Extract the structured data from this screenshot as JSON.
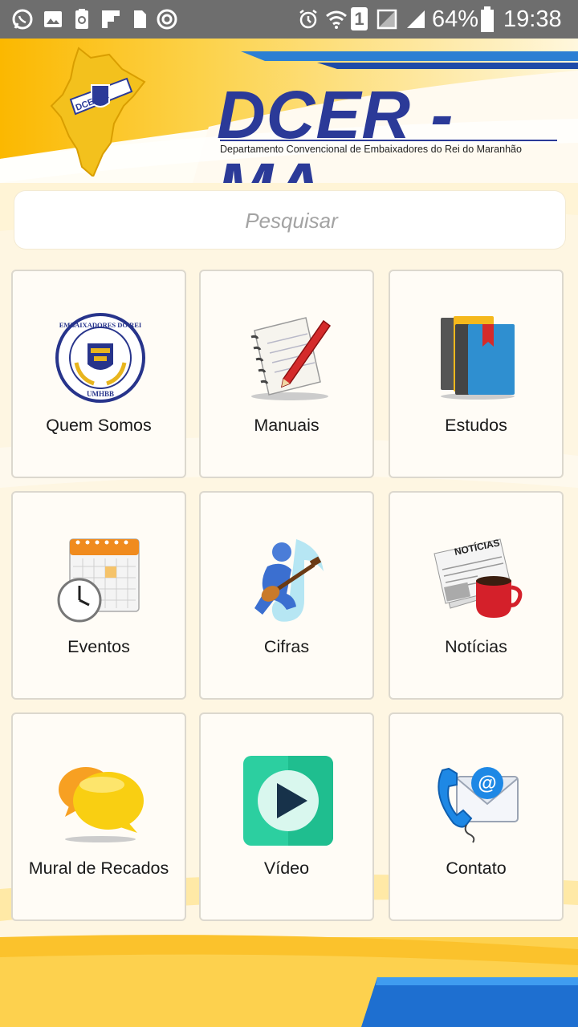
{
  "status_bar": {
    "battery": "64%",
    "time": "19:38",
    "sim_label": "1",
    "icons": [
      "whatsapp-icon",
      "gallery-icon",
      "recycle-icon",
      "flipboard-icon",
      "sim-icon",
      "sync-icon",
      "alarm-icon",
      "wifi-icon",
      "sim-1-icon",
      "no-signal-icon",
      "signal-icon",
      "battery-icon"
    ]
  },
  "header": {
    "title": "DCER - MA",
    "subtitle": "Departamento Convencional de Embaixadores do Rei do Maranhão",
    "logo_letters": "DCE MA",
    "colors": {
      "blue": "#2b3a98",
      "yellow": "#f7c51c"
    }
  },
  "search": {
    "placeholder": "Pesquisar"
  },
  "menu": [
    {
      "label": "Quem Somos",
      "icon": "embaixadores-emblem-icon",
      "emblem_top": "EMBAIXADORES DO REI",
      "emblem_bottom": "UMHBB"
    },
    {
      "label": "Manuais",
      "icon": "notepad-pencil-icon"
    },
    {
      "label": "Estudos",
      "icon": "books-icon"
    },
    {
      "label": "Eventos",
      "icon": "calendar-clock-icon"
    },
    {
      "label": "Cifras",
      "icon": "guitar-player-icon"
    },
    {
      "label": "Notícias",
      "icon": "newspaper-coffee-icon",
      "newspaper_title": "NOTÍCIAS"
    },
    {
      "label": "Mural de Recados",
      "icon": "chat-bubbles-icon"
    },
    {
      "label": "Vídeo",
      "icon": "video-play-icon"
    },
    {
      "label": "Contato",
      "icon": "phone-email-icon"
    }
  ]
}
